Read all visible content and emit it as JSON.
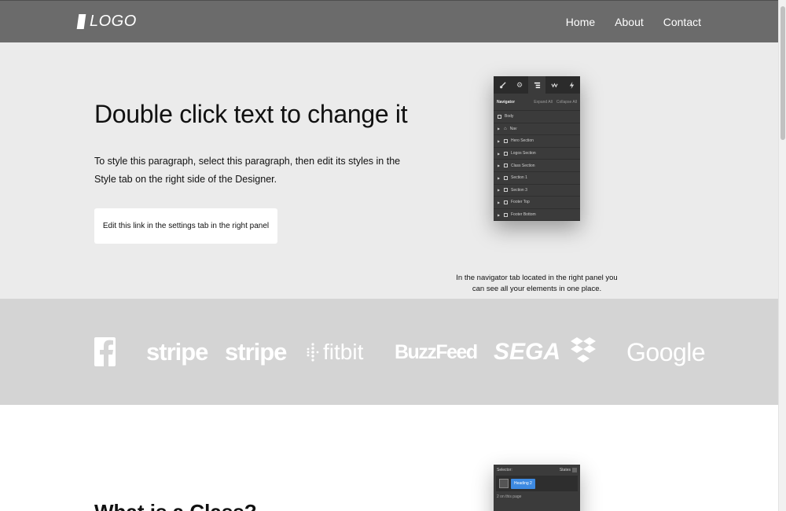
{
  "nav": {
    "logo_text": "LOGO",
    "links": [
      "Home",
      "About",
      "Contact"
    ]
  },
  "hero": {
    "title": "Double click text to change it",
    "paragraph": "To style this paragraph, select this paragraph, then edit its styles in the Style tab on the right side of the Designer.",
    "button_label": "Edit this link in the settings tab in the right panel",
    "caption": "In the navigator tab located in the right panel you can see all your elements in one place."
  },
  "navigator_panel": {
    "tab_icons": [
      "brush-icon",
      "gear-icon",
      "navigator-icon",
      "interactions-icon",
      "lightning-icon"
    ],
    "title": "Navigator",
    "expand_all": "Expand All",
    "collapse_all": "Collapse All",
    "items": [
      "Body",
      "Nav",
      "Hero Section",
      "Logos Section",
      "Class Section",
      "Section 1",
      "Section 3",
      "Footer Top",
      "Footer Bottom"
    ]
  },
  "logos": [
    "facebook-logo",
    "stripe",
    "stripe",
    "fitbit",
    "BuzzFeed",
    "SEGA",
    "dropbox-logo",
    "Google"
  ],
  "logo_texts": {
    "stripe1": "stripe",
    "stripe2": "stripe",
    "fitbit": "fitbit",
    "buzzfeed": "BuzzFeed",
    "sega": "SEGA",
    "google": "Google"
  },
  "second_section": {
    "title": "What is a Class?"
  },
  "selector_panel": {
    "label": "Selector:",
    "states": "States",
    "chip": "Heading 2",
    "count": "2 on this page"
  }
}
